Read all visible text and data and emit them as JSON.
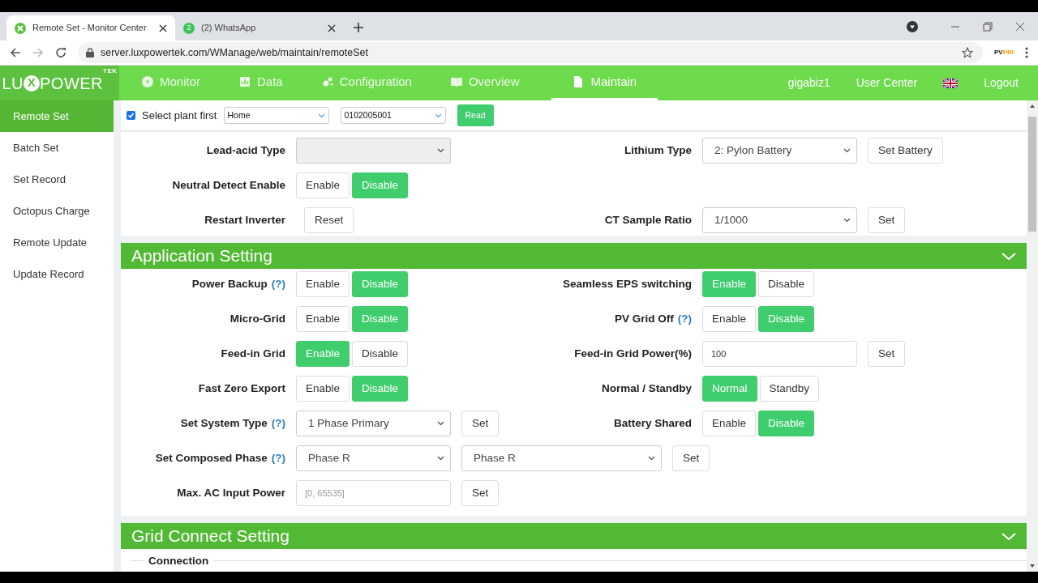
{
  "browser": {
    "tabs": [
      {
        "title": "Remote Set - Monitor Center",
        "selected": true,
        "kind": "site"
      },
      {
        "title": "(2) WhatsApp",
        "selected": false,
        "kind": "chat",
        "badge": "2"
      }
    ],
    "url": "server.luxpowertek.com/WManage/web/maintain/remoteSet",
    "extension": {
      "part_1": "PV",
      "part_2": "PRI"
    }
  },
  "nav": {
    "logo": {
      "prefix": "LU",
      "mark": "X",
      "suffix": "POWER",
      "sup": "TEK"
    },
    "items": [
      {
        "label": "Monitor",
        "selected": false
      },
      {
        "label": "Data",
        "selected": false
      },
      {
        "label": "Configuration",
        "selected": false
      },
      {
        "label": "Overview",
        "selected": false
      },
      {
        "label": "Maintain",
        "selected": true
      }
    ],
    "user": "gigabiz1",
    "user_center": "User Center",
    "logout": "Logout"
  },
  "sidebar": {
    "items": [
      {
        "label": "Remote Set",
        "selected": true
      },
      {
        "label": "Batch Set",
        "selected": false
      },
      {
        "label": "Set Record",
        "selected": false
      },
      {
        "label": "Octopus Charge",
        "selected": false
      },
      {
        "label": "Remote Update",
        "selected": false
      },
      {
        "label": "Update Record",
        "selected": false
      }
    ]
  },
  "plant_selector": {
    "checked": true,
    "label": "Select plant first",
    "plant": "Home",
    "serial": "0102005001",
    "button": "Read"
  },
  "sections": [
    {
      "rows": [
        {
          "left": {
            "label": "Lead-acid Type",
            "controls": [
              {
                "kind": "select",
                "disabled": true
              }
            ]
          },
          "right": {
            "label": "Lithium Type",
            "controls": [
              {
                "kind": "select",
                "value": "2: Pylon Battery"
              },
              {
                "kind": "button",
                "label": "Set Battery"
              }
            ]
          }
        },
        {
          "left": {
            "label": "Neutral Detect Enable",
            "controls": [
              {
                "kind": "toggle",
                "label": "Enable",
                "selected": false
              },
              {
                "kind": "toggle",
                "label": "Disable",
                "selected": true
              }
            ]
          }
        },
        {
          "left": {
            "label": "Restart Inverter",
            "controls": [
              {
                "kind": "button",
                "label": "Reset"
              }
            ]
          },
          "right": {
            "label": "CT Sample Ratio",
            "controls": [
              {
                "kind": "select",
                "value": "1/1000"
              },
              {
                "kind": "button",
                "label": "Set"
              }
            ]
          }
        }
      ]
    },
    {
      "title": "Application Setting",
      "expanded": true,
      "rows": [
        {
          "left": {
            "label": "Power Backup",
            "help": "(?)",
            "controls": [
              {
                "kind": "toggle",
                "label": "Enable",
                "selected": false
              },
              {
                "kind": "toggle",
                "label": "Disable",
                "selected": true
              }
            ]
          },
          "right": {
            "label": "Seamless EPS switching",
            "controls": [
              {
                "kind": "toggle",
                "label": "Enable",
                "selected": true
              },
              {
                "kind": "toggle",
                "label": "Disable",
                "selected": false
              }
            ]
          }
        },
        {
          "left": {
            "label": "Micro-Grid",
            "controls": [
              {
                "kind": "toggle",
                "label": "Enable",
                "selected": false
              },
              {
                "kind": "toggle",
                "label": "Disable",
                "selected": true
              }
            ]
          },
          "right": {
            "label": "PV Grid Off",
            "help": "(?)",
            "controls": [
              {
                "kind": "toggle",
                "label": "Enable",
                "selected": false
              },
              {
                "kind": "toggle",
                "label": "Disable",
                "selected": true
              }
            ]
          }
        },
        {
          "left": {
            "label": "Feed-in Grid",
            "controls": [
              {
                "kind": "toggle",
                "label": "Enable",
                "selected": true
              },
              {
                "kind": "toggle",
                "label": "Disable",
                "selected": false
              }
            ]
          },
          "right": {
            "label": "Feed-in Grid Power(%)",
            "controls": [
              {
                "kind": "input",
                "value": "100"
              },
              {
                "kind": "button",
                "label": "Set"
              }
            ]
          }
        },
        {
          "left": {
            "label": "Fast Zero Export",
            "controls": [
              {
                "kind": "toggle",
                "label": "Enable",
                "selected": false
              },
              {
                "kind": "toggle",
                "label": "Disable",
                "selected": true
              }
            ]
          },
          "right": {
            "label": "Normal / Standby",
            "controls": [
              {
                "kind": "toggle",
                "label": "Normal",
                "selected": true
              },
              {
                "kind": "toggle",
                "label": "Standby",
                "selected": false
              }
            ]
          }
        },
        {
          "left": {
            "label": "Set System Type",
            "help": "(?)",
            "controls": [
              {
                "kind": "select",
                "value": "1 Phase Primary"
              },
              {
                "kind": "button",
                "label": "Set"
              }
            ]
          },
          "right": {
            "label": "Battery Shared",
            "controls": [
              {
                "kind": "toggle",
                "label": "Enable",
                "selected": false
              },
              {
                "kind": "toggle",
                "label": "Disable",
                "selected": true
              }
            ]
          }
        },
        {
          "left": {
            "label": "Set Composed Phase",
            "help": "(?)",
            "controls": [
              {
                "kind": "select",
                "value": "Phase R"
              },
              {
                "kind": "select",
                "value": "Phase R",
                "wide": true
              },
              {
                "kind": "button",
                "label": "Set"
              }
            ]
          }
        },
        {
          "left": {
            "label": "Max. AC Input Power",
            "controls": [
              {
                "kind": "input",
                "placeholder": "[0, 65535]"
              },
              {
                "kind": "button",
                "label": "Set"
              }
            ]
          }
        }
      ]
    },
    {
      "title": "Grid Connect Setting",
      "expanded": true,
      "legend": "Connection"
    }
  ]
}
